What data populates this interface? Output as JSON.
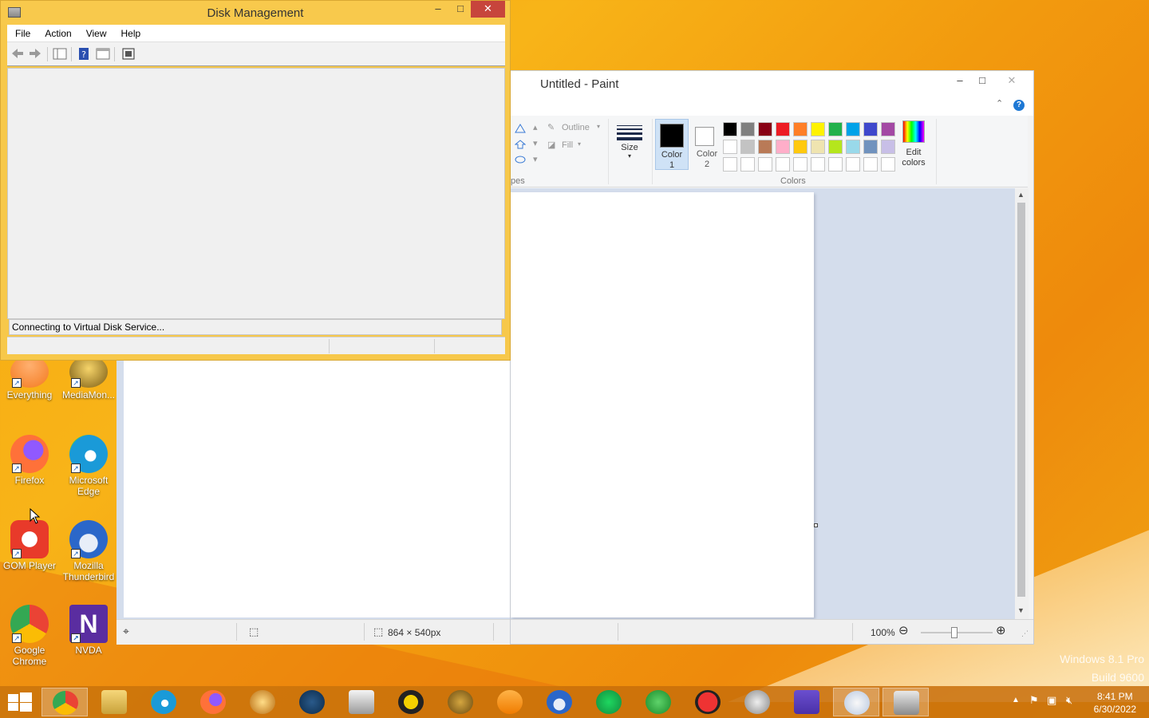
{
  "desktop": {
    "watermark_line1": "Windows 8.1 Pro",
    "watermark_line2": "Build 9600",
    "icons": [
      {
        "label": "Everything",
        "color": "#f47a1f"
      },
      {
        "label": "MediaMon...",
        "color": "#f0c040"
      },
      {
        "label": "Firefox",
        "color": "#ff7139"
      },
      {
        "label": "Microsoft Edge",
        "color": "#1a9ad8"
      },
      {
        "label": "GOM Player",
        "color": "#e83a2a"
      },
      {
        "label": "Mozilla Thunderbird",
        "color": "#2b67c9"
      },
      {
        "label": "Google Chrome",
        "color": "#34a853"
      },
      {
        "label": "NVDA",
        "color": "#5a2da0"
      }
    ]
  },
  "disk_management": {
    "title": "Disk Management",
    "menu": [
      "File",
      "Action",
      "View",
      "Help"
    ],
    "status_message": "Connecting to Virtual Disk Service...",
    "toolbar_icons": [
      "back-icon",
      "forward-icon",
      "console-tree-icon",
      "help-icon",
      "properties-icon",
      "rescan-icon"
    ]
  },
  "paint": {
    "title": "Untitled - Paint",
    "ribbon": {
      "shapes_group_label": "pes",
      "outline_label": "Outline",
      "fill_label": "Fill",
      "size_label": "Size",
      "color1_label_a": "Color",
      "color1_label_b": "1",
      "color2_label_a": "Color",
      "color2_label_b": "2",
      "colors_group_label": "Colors",
      "edit_colors_a": "Edit",
      "edit_colors_b": "colors",
      "palette_row1": [
        "#000000",
        "#7f7f7f",
        "#880015",
        "#ed1c24",
        "#ff7f27",
        "#fff200",
        "#22b14c",
        "#00a2e8",
        "#3f48cc",
        "#a349a4"
      ],
      "palette_row2": [
        "#ffffff",
        "#c3c3c3",
        "#b97a57",
        "#ffaec9",
        "#ffc90e",
        "#efe4b0",
        "#b5e61d",
        "#99d9ea",
        "#7092be",
        "#c8bfe7"
      ]
    },
    "status": {
      "canvas_size": "864 × 540px",
      "zoom": "100%"
    }
  },
  "taskbar": {
    "apps": [
      "chrome",
      "file-explorer",
      "edge",
      "firefox",
      "everything",
      "steam",
      "media-player-321",
      "aimp",
      "mediamonkey",
      "vlc",
      "thunderbird",
      "spotify",
      "evernote",
      "blocked-app",
      "pro-app",
      "settings-gear",
      "paint",
      "disk-management"
    ],
    "clock_time": "8:41 PM",
    "clock_date": "6/30/2022"
  }
}
